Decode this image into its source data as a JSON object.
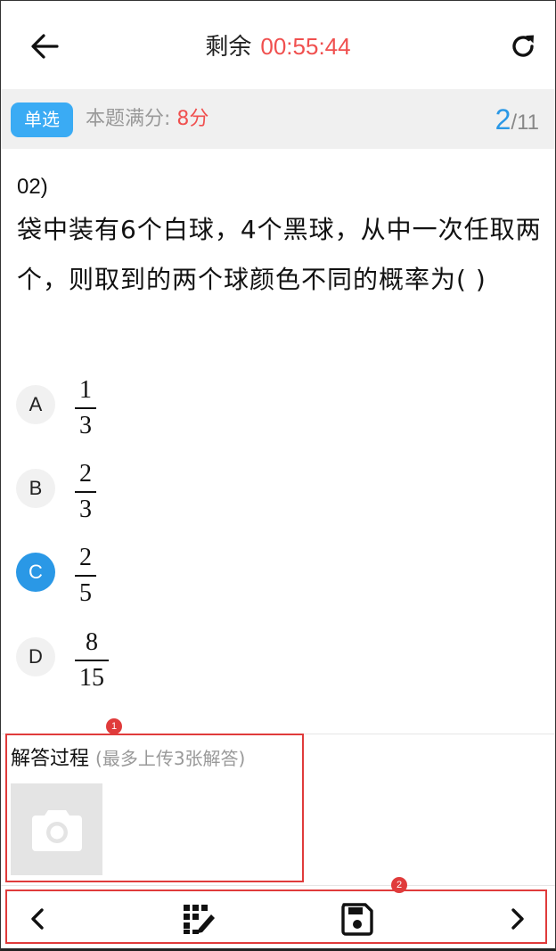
{
  "header": {
    "timer_label": "剩余",
    "timer_value": "00:55:44",
    "back_icon": "arrow-left-icon",
    "refresh_icon": "refresh-icon"
  },
  "info": {
    "type_badge": "单选",
    "score_label": "本题满分:",
    "score_value": "8分",
    "progress_current": "2",
    "progress_total": "/11"
  },
  "question": {
    "number": "02)",
    "text": "袋中装有6个白球，4个黑球，从中一次任取两个，则取到的两个球颜色不同的概率为(   )"
  },
  "options": [
    {
      "letter": "A",
      "numerator": "1",
      "denominator": "3",
      "selected": false
    },
    {
      "letter": "B",
      "numerator": "2",
      "denominator": "3",
      "selected": false
    },
    {
      "letter": "C",
      "numerator": "2",
      "denominator": "5",
      "selected": true
    },
    {
      "letter": "D",
      "numerator": "8",
      "denominator": "15",
      "selected": false
    }
  ],
  "answer": {
    "title": "解答过程",
    "hint": "(最多上传3张解答)",
    "upload_icon": "camera-icon"
  },
  "annotations": {
    "marker_1": "1",
    "marker_2": "2"
  },
  "toolbar": {
    "prev_icon": "chevron-left-icon",
    "grid_icon": "answer-sheet-icon",
    "save_icon": "save-icon",
    "next_icon": "chevron-right-icon"
  },
  "colors": {
    "accent_blue": "#2a98e6",
    "badge_blue": "#3aabf4",
    "timer_red": "#f0504f",
    "highlight_red": "#e03b3b"
  }
}
